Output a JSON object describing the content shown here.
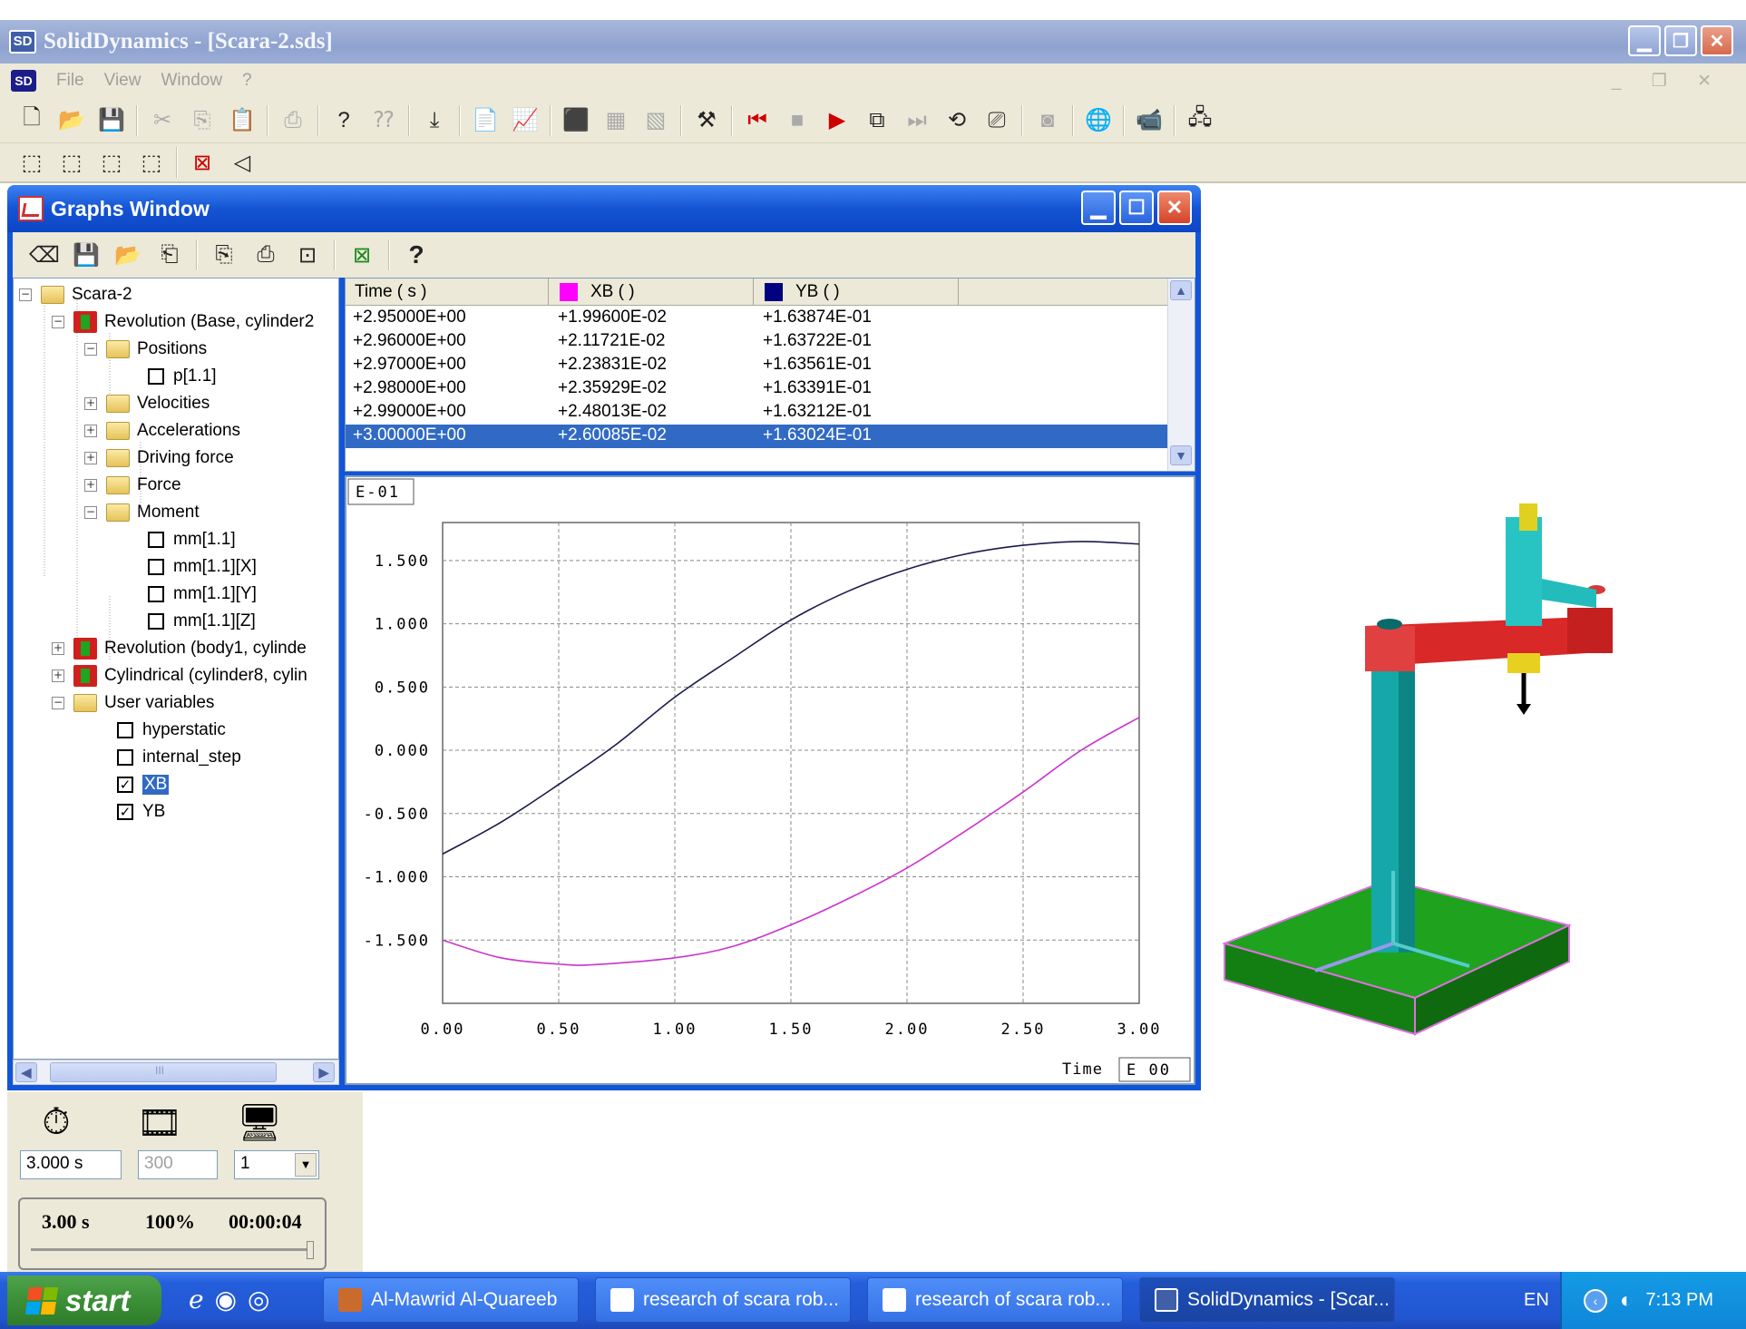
{
  "app": {
    "title": "SolidDynamics - [Scara-2.sds]",
    "logo": "SD",
    "menu": [
      "File",
      "View",
      "Window",
      "?"
    ]
  },
  "graphs_window": {
    "title": "Graphs Window",
    "help": "?"
  },
  "tree": {
    "root": "Scara-2",
    "revolution1": "Revolution (Base, cylinder2",
    "positions": "Positions",
    "p11": "p[1.1]",
    "velocities": "Velocities",
    "accelerations": "Accelerations",
    "driving_force": "Driving force",
    "force": "Force",
    "moment": "Moment",
    "mm11": "mm[1.1]",
    "mm11x": "mm[1.1][X]",
    "mm11y": "mm[1.1][Y]",
    "mm11z": "mm[1.1][Z]",
    "revolution2": "Revolution (body1, cylinde",
    "cylindrical": "Cylindrical (cylinder8, cylin",
    "user_variables": "User variables",
    "hyperstatic": "hyperstatic",
    "internal_step": "internal_step",
    "xb": "XB",
    "yb": "YB",
    "scroll_grip": "III"
  },
  "table": {
    "headers": {
      "time": "Time ( s )",
      "xb": "XB ( )",
      "yb": "YB ( )"
    },
    "colors": {
      "xb": "#ff00ff",
      "yb": "#000080"
    },
    "rows": [
      {
        "t": "+2.95000E+00",
        "xb": "+1.99600E-02",
        "yb": "+1.63874E-01"
      },
      {
        "t": "+2.96000E+00",
        "xb": "+2.11721E-02",
        "yb": "+1.63722E-01"
      },
      {
        "t": "+2.97000E+00",
        "xb": "+2.23831E-02",
        "yb": "+1.63561E-01"
      },
      {
        "t": "+2.98000E+00",
        "xb": "+2.35929E-02",
        "yb": "+1.63391E-01"
      },
      {
        "t": "+2.99000E+00",
        "xb": "+2.48013E-02",
        "yb": "+1.63212E-01"
      },
      {
        "t": "+3.00000E+00",
        "xb": "+2.60085E-02",
        "yb": "+1.63024E-01"
      }
    ],
    "selected_row": 5
  },
  "chart_data": {
    "type": "line",
    "y_exponent_label": "E-01",
    "x_exponent_label": "E 00",
    "xlabel": "Time",
    "xlim": [
      0,
      3
    ],
    "ylim": [
      -2.0,
      1.8
    ],
    "x_ticks": [
      "0.00",
      "0.50",
      "1.00",
      "1.50",
      "2.00",
      "2.50",
      "3.00"
    ],
    "y_ticks": [
      "1.500",
      "1.000",
      "0.500",
      "0.000",
      "-0.500",
      "-1.000",
      "-1.500"
    ],
    "grid": true,
    "series": [
      {
        "name": "XB",
        "color": "#cc33cc",
        "x": [
          0,
          0.25,
          0.5,
          0.65,
          1.0,
          1.25,
          1.5,
          1.75,
          2.0,
          2.25,
          2.5,
          2.75,
          3.0
        ],
        "y": [
          -1.5,
          -1.64,
          -1.69,
          -1.695,
          -1.64,
          -1.55,
          -1.38,
          -1.17,
          -0.93,
          -0.64,
          -0.33,
          0.0,
          0.26
        ]
      },
      {
        "name": "YB",
        "color": "#1a1a4d",
        "x": [
          0,
          0.25,
          0.5,
          0.75,
          1.0,
          1.25,
          1.5,
          1.75,
          2.0,
          2.25,
          2.5,
          2.75,
          3.0
        ],
        "y": [
          -0.82,
          -0.57,
          -0.27,
          0.05,
          0.42,
          0.73,
          1.03,
          1.26,
          1.43,
          1.55,
          1.62,
          1.65,
          1.63
        ]
      }
    ]
  },
  "sim_panel": {
    "end_time": "3.000 s",
    "steps": "300",
    "skip": "1",
    "current_time": "3.00 s",
    "percent": "100%",
    "elapsed": "00:00:04"
  },
  "taskbar": {
    "start": "start",
    "tasks": [
      "Al-Mawrid Al-Quareeb",
      "research of scara rob...",
      "research of scara rob...",
      "SolidDynamics - [Scar..."
    ],
    "lang": "EN",
    "clock": "7:13 PM"
  }
}
